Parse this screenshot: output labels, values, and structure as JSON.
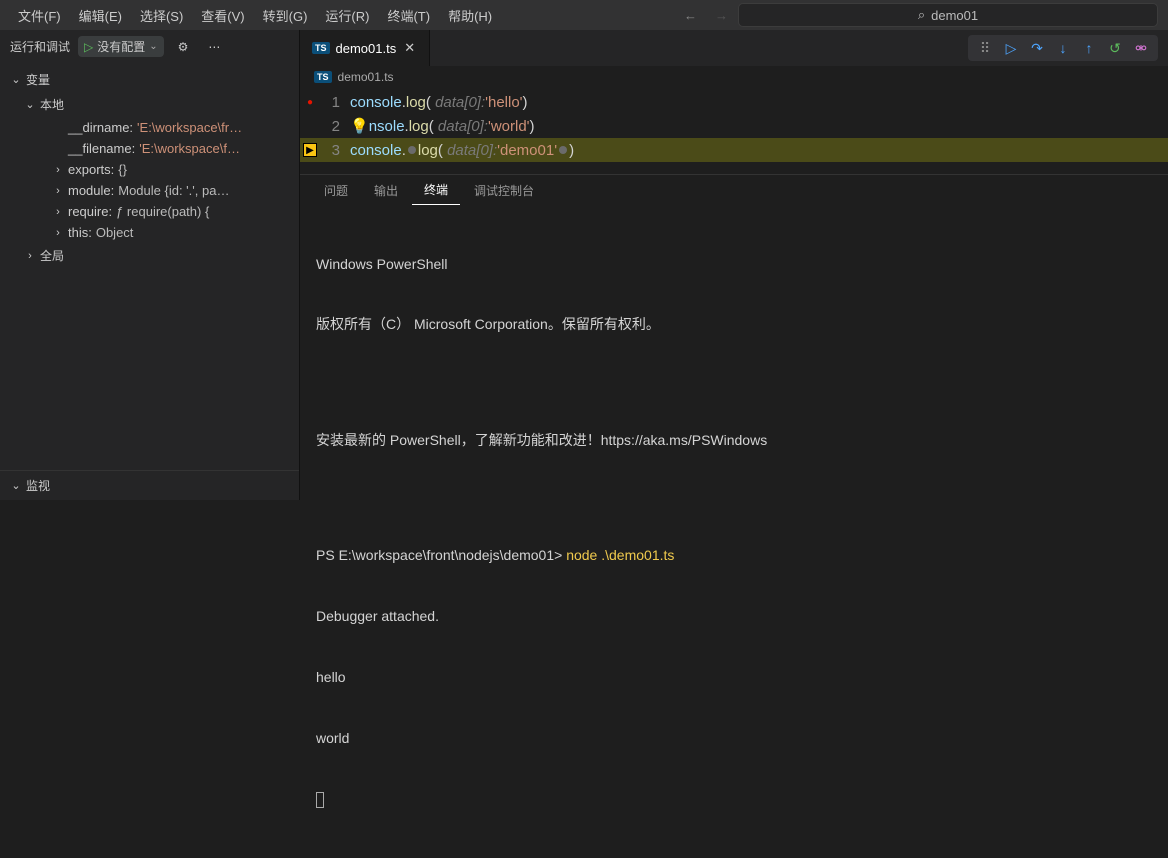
{
  "menubar": {
    "items": [
      "文件(F)",
      "编辑(E)",
      "选择(S)",
      "查看(V)",
      "转到(G)",
      "运行(R)",
      "终端(T)",
      "帮助(H)"
    ],
    "search_text": "demo01"
  },
  "debugSidebar": {
    "title": "运行和调试",
    "config_label": "没有配置",
    "sections": {
      "variables": "变量",
      "local": "本地",
      "global": "全局",
      "watch": "监视"
    },
    "vars": [
      {
        "chev": "",
        "name": "__dirname:",
        "value": "'E:\\workspace\\fr…",
        "cls": "var-val"
      },
      {
        "chev": "",
        "name": "__filename:",
        "value": "'E:\\workspace\\f…",
        "cls": "var-val"
      },
      {
        "chev": "›",
        "name": "exports:",
        "value": "{}",
        "cls": "var-val obj"
      },
      {
        "chev": "›",
        "name": "module:",
        "value": "Module {id: '.', pa…",
        "cls": "var-val obj"
      },
      {
        "chev": "›",
        "name": "require:",
        "value": "ƒ require(path) {",
        "cls": "var-val fn"
      },
      {
        "chev": "›",
        "name": "this:",
        "value": "Object",
        "cls": "var-val obj"
      }
    ]
  },
  "editor": {
    "tab_filename": "demo01.ts",
    "breadcrumb_file": "demo01.ts",
    "lines": [
      {
        "bp": "red",
        "num": "1",
        "pre_obj": "console",
        "log_fn": "log",
        "hint": "data[0]:",
        "str": "'hello'",
        "bulb": false,
        "hl": false
      },
      {
        "bp": "",
        "num": "2",
        "pre_obj": "nsole",
        "log_fn": "log",
        "hint": "data[0]:",
        "str": "'world'",
        "bulb": true,
        "hl": false
      },
      {
        "bp": "arrow",
        "num": "3",
        "pre_obj": "console",
        "log_fn": "log",
        "hint": "data[0]:",
        "str": "'demo01'",
        "bulb": false,
        "hl": true,
        "dots": true
      }
    ]
  },
  "panel": {
    "tabs": {
      "problems": "问题",
      "output": "输出",
      "terminal": "终端",
      "debug_console": "调试控制台"
    },
    "terminal": {
      "l1": "Windows PowerShell",
      "l2": "版权所有（C） Microsoft Corporation。保留所有权利。",
      "l3": "安装最新的 PowerShell，了解新功能和改进！https://aka.ms/PSWindows",
      "prompt_path": "PS E:\\workspace\\front\\nodejs\\demo01> ",
      "prompt_cmd": "node .\\demo01.ts",
      "o1": "Debugger attached.",
      "o2": "hello",
      "o3": "world"
    }
  }
}
